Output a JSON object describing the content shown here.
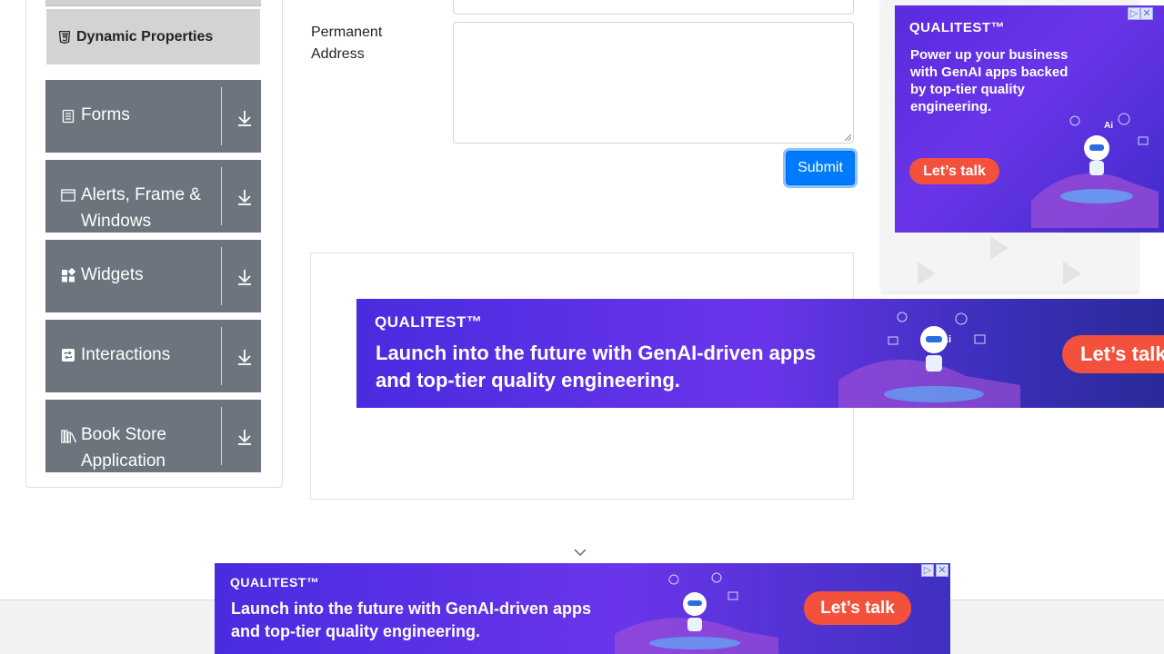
{
  "sidebar": {
    "sub_item": {
      "label": "Dynamic Properties",
      "icon": "html5-icon"
    },
    "groups": [
      {
        "label": "Forms",
        "icon": "form-icon"
      },
      {
        "label": "Alerts, Frame & Windows",
        "icon": "window-icon"
      },
      {
        "label": "Widgets",
        "icon": "widgets-icon"
      },
      {
        "label": "Interactions",
        "icon": "interactions-icon"
      },
      {
        "label": "Book Store Application",
        "icon": "books-icon"
      }
    ]
  },
  "form": {
    "permanent_address_label": "Permanent Address",
    "permanent_address_value": "",
    "submit_label": "Submit"
  },
  "ads": {
    "right": {
      "brand": "QUALITEST™",
      "text": "Power up your business with GenAI apps backed by top-tier quality engineering.",
      "cta": "Let’s talk"
    },
    "middle": {
      "brand": "QUALITEST™",
      "text": "Launch into the future with GenAI-driven apps and top-tier quality engineering.",
      "cta": "Let’s talk"
    },
    "bottom": {
      "brand": "QUALITEST™",
      "text": "Launch into the future with GenAI-driven apps and top-tier quality engineering.",
      "cta": "Let’s talk"
    }
  },
  "colors": {
    "sidebar_group_bg": "#6c757d",
    "submit_bg": "#007bff",
    "ad_purple": "#5a2be0",
    "ad_cta": "#f4513c"
  }
}
